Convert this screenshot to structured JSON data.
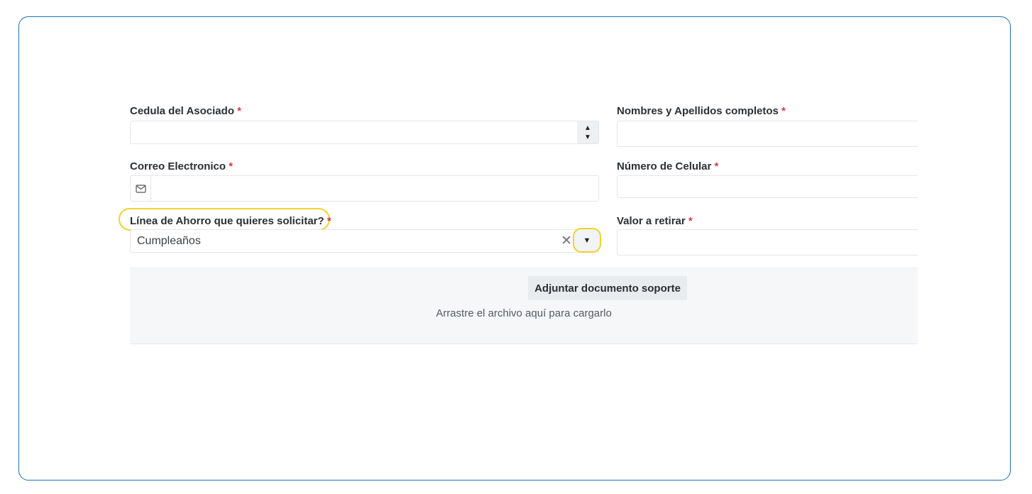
{
  "form": {
    "cedula": {
      "label": "Cedula del Asociado",
      "required_mark": "*",
      "value": "",
      "step_up": "▲",
      "step_down": "▼"
    },
    "nombres": {
      "label": "Nombres y Apellidos completos",
      "required_mark": "*",
      "value": ""
    },
    "correo": {
      "label": "Correo Electronico",
      "required_mark": "*",
      "value": "",
      "icon": "envelope-icon"
    },
    "celular": {
      "label": "Número de Celular",
      "required_mark": "*",
      "value": ""
    },
    "linea": {
      "label": "Línea de Ahorro que quieres solicitar?",
      "required_mark": "*",
      "selected": "Cumpleaños",
      "clear_glyph": "✕",
      "dropdown_glyph": "▼"
    },
    "valor": {
      "label": "Valor a retirar",
      "required_mark": "*",
      "value": ""
    }
  },
  "upload": {
    "button_label": "Adjuntar documento soporte",
    "hint": "Arrastre el archivo aquí para cargarlo"
  },
  "colors": {
    "frame_border": "#1f6fb8",
    "required": "#dc3545",
    "highlight": "#f2d22e"
  }
}
